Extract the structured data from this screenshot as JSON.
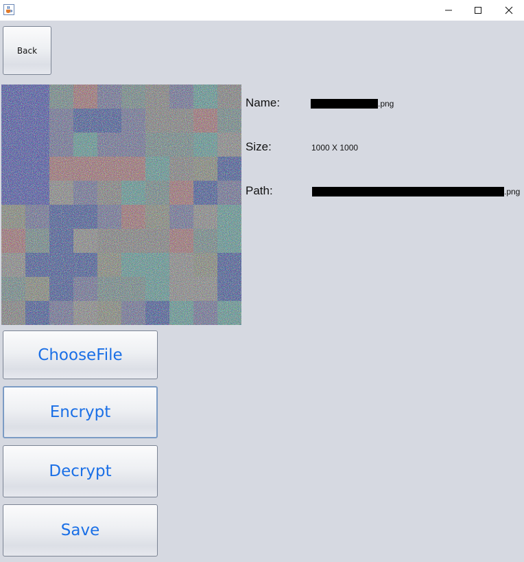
{
  "window": {
    "icon": "java-cup-icon",
    "controls": [
      "minimize-icon",
      "maximize-icon",
      "close-icon"
    ]
  },
  "toolbar": {
    "back_label": "Back"
  },
  "info": {
    "name_label": "Name:",
    "name_suffix": ".png",
    "size_label": "Size:",
    "size_value": "1000 X 1000",
    "path_label": "Path:",
    "path_suffix": ".png"
  },
  "actions": {
    "choose_label": "ChooseFile",
    "encrypt_label": "Encrypt",
    "decrypt_label": "Decrypt",
    "save_label": "Save"
  },
  "colors": {
    "background": "#d6d9e1",
    "button_text": "#1a6fe6",
    "redaction": "#000000"
  }
}
